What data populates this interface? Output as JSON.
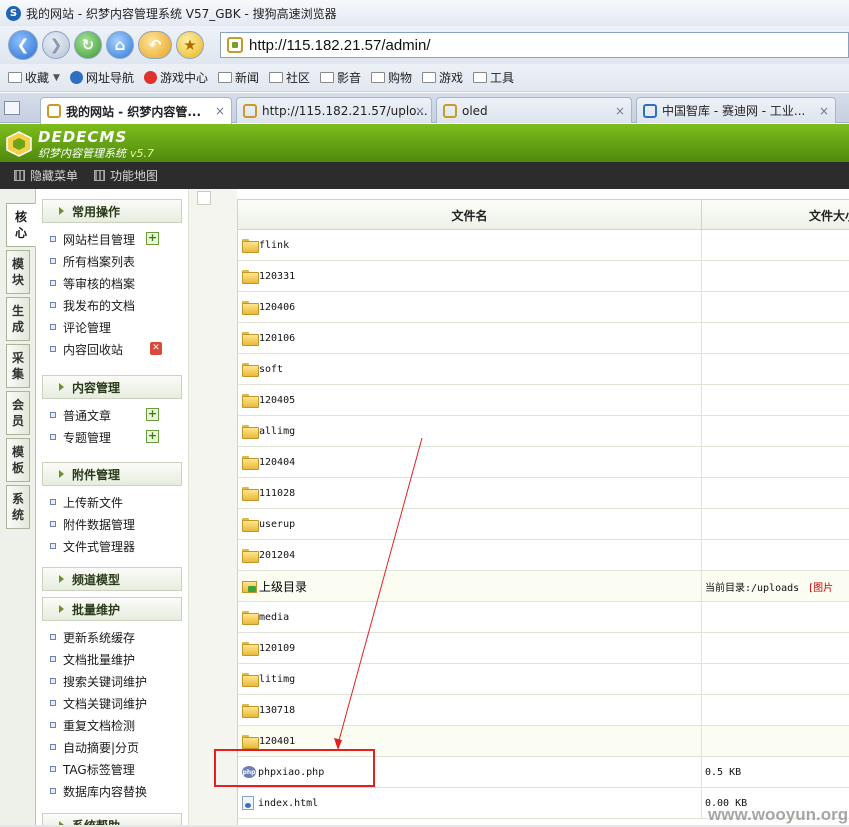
{
  "browser": {
    "window_title": "我的网站 - 织梦内容管理系统 V57_GBK - 搜狗高速浏览器",
    "address_url": "http://115.182.21.57/admin/",
    "bookmarks": [
      {
        "label": "收藏",
        "icon": "star-icon"
      },
      {
        "label": "网址导航",
        "icon": "sogou-icon"
      },
      {
        "label": "游戏中心",
        "icon": "game-icon"
      },
      {
        "label": "新闻",
        "icon": "folder-icon"
      },
      {
        "label": "社区",
        "icon": "folder-icon"
      },
      {
        "label": "影音",
        "icon": "folder-icon"
      },
      {
        "label": "购物",
        "icon": "folder-icon"
      },
      {
        "label": "游戏",
        "icon": "folder-icon"
      },
      {
        "label": "工具",
        "icon": "folder-icon"
      }
    ],
    "tabs": [
      {
        "label": "我的网站 - 织梦内容管...",
        "active": true
      },
      {
        "label": "http://115.182.21.57/uplo...",
        "active": false
      },
      {
        "label": "oled",
        "active": false
      },
      {
        "label": "中国智库 - 赛迪网 - 工业...",
        "active": false
      }
    ],
    "close_glyph": "×"
  },
  "cms": {
    "logo_text": "DEDECMS",
    "logo_subtitle": "织梦内容管理系统",
    "version": "v5.7",
    "toolbar": [
      {
        "label": "隐藏菜单"
      },
      {
        "label": "功能地图"
      }
    ],
    "vertical_tabs": [
      {
        "top": "核",
        "bottom": "心",
        "active": true
      },
      {
        "top": "模",
        "bottom": "块",
        "active": false
      },
      {
        "top": "生",
        "bottom": "成",
        "active": false
      },
      {
        "top": "采",
        "bottom": "集",
        "active": false
      },
      {
        "top": "会",
        "bottom": "员",
        "active": false
      },
      {
        "top": "模",
        "bottom": "板",
        "active": false
      },
      {
        "top": "系",
        "bottom": "统",
        "active": false
      }
    ],
    "menu": {
      "sections": [
        {
          "title": "常用操作",
          "items": [
            "网站栏目管理",
            "所有档案列表",
            "等审核的档案",
            "我发布的文档",
            "评论管理",
            "内容回收站"
          ]
        },
        {
          "title": "内容管理",
          "items": [
            "普通文章",
            "专题管理"
          ]
        },
        {
          "title": "附件管理",
          "items": [
            "上传新文件",
            "附件数据管理",
            "文件式管理器"
          ]
        },
        {
          "title": "频道模型",
          "items": []
        },
        {
          "title": "批量维护",
          "items": [
            "更新系统缓存",
            "文档批量维护",
            "搜索关键词维护",
            "文档关键词维护",
            "重复文档检测",
            "自动摘要|分页",
            "TAG标签管理",
            "数据库内容替换"
          ]
        },
        {
          "title": "系统帮助",
          "items": []
        }
      ]
    }
  },
  "file_table": {
    "col_name": "文件名",
    "col_size": "文件大小",
    "rows": [
      {
        "name": "flink",
        "type": "folder",
        "size": ""
      },
      {
        "name": "120331",
        "type": "folder",
        "size": ""
      },
      {
        "name": "120406",
        "type": "folder",
        "size": ""
      },
      {
        "name": "120106",
        "type": "folder",
        "size": ""
      },
      {
        "name": "soft",
        "type": "folder",
        "size": ""
      },
      {
        "name": "120405",
        "type": "folder",
        "size": ""
      },
      {
        "name": "allimg",
        "type": "folder",
        "size": ""
      },
      {
        "name": "120404",
        "type": "folder",
        "size": ""
      },
      {
        "name": "111028",
        "type": "folder",
        "size": ""
      },
      {
        "name": "userup",
        "type": "folder",
        "size": ""
      },
      {
        "name": "201204",
        "type": "folder",
        "size": ""
      },
      {
        "name": "上级目录",
        "type": "parent",
        "size": "当前目录:/uploads",
        "extra": "[图片"
      },
      {
        "name": "media",
        "type": "folder",
        "size": ""
      },
      {
        "name": "120109",
        "type": "folder",
        "size": ""
      },
      {
        "name": "litimg",
        "type": "folder",
        "size": ""
      },
      {
        "name": "130718",
        "type": "folder",
        "size": ""
      },
      {
        "name": "120401",
        "type": "folder",
        "size": ""
      },
      {
        "name": "phpxiao.php",
        "type": "php",
        "size": "0.5 KB"
      },
      {
        "name": "index.html",
        "type": "html",
        "size": "0.00 KB"
      }
    ]
  },
  "annotation": {
    "highlight_color": "#e41f1f"
  },
  "watermark": "www.wooyun.org"
}
